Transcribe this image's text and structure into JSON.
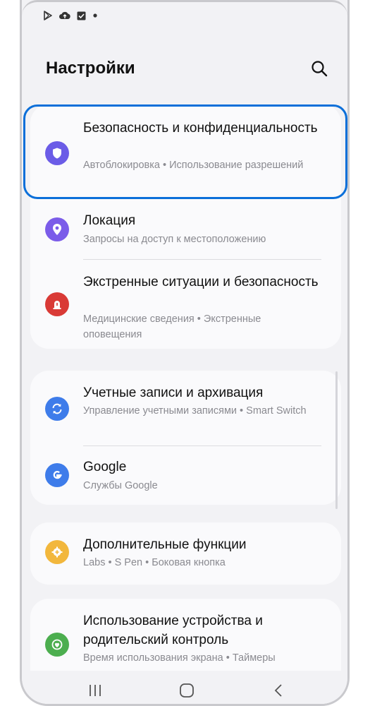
{
  "header": {
    "title": "Настройки"
  },
  "groups": [
    {
      "items": [
        {
          "title": "Безопасность и конфиденциальность",
          "subtitle": "Автоблокировка • Использование разрешений",
          "icon": "shield-icon",
          "color": "#6b5ce7"
        },
        {
          "title": "Локация",
          "subtitle": "Запросы на доступ к местоположению",
          "icon": "location-pin-icon",
          "color": "#7b5ce9"
        },
        {
          "title": "Экстренные ситуации и безопасность",
          "subtitle": "Медицинские сведения • Экстренные оповещения",
          "icon": "emergency-light-icon",
          "color": "#d93a36"
        }
      ]
    },
    {
      "items": [
        {
          "title": "Учетные записи и архивация",
          "subtitle": "Управление учетными записями • Smart Switch",
          "icon": "sync-icon",
          "color": "#3e7cea"
        },
        {
          "title": "Google",
          "subtitle": "Службы Google",
          "icon": "google-icon",
          "color": "#3e7cea"
        }
      ]
    },
    {
      "items": [
        {
          "title": "Дополнительные функции",
          "subtitle": "Labs • S Pen • Боковая кнопка",
          "icon": "gear-plus-icon",
          "color": "#f2b73c"
        }
      ]
    },
    {
      "items": [
        {
          "title": "Использование устройства и родительский контроль",
          "subtitle": "Время использования экрана • Таймеры",
          "icon": "wellbeing-icon",
          "color": "#4cae4f"
        }
      ]
    }
  ],
  "highlight_color": "#0b6fd9"
}
